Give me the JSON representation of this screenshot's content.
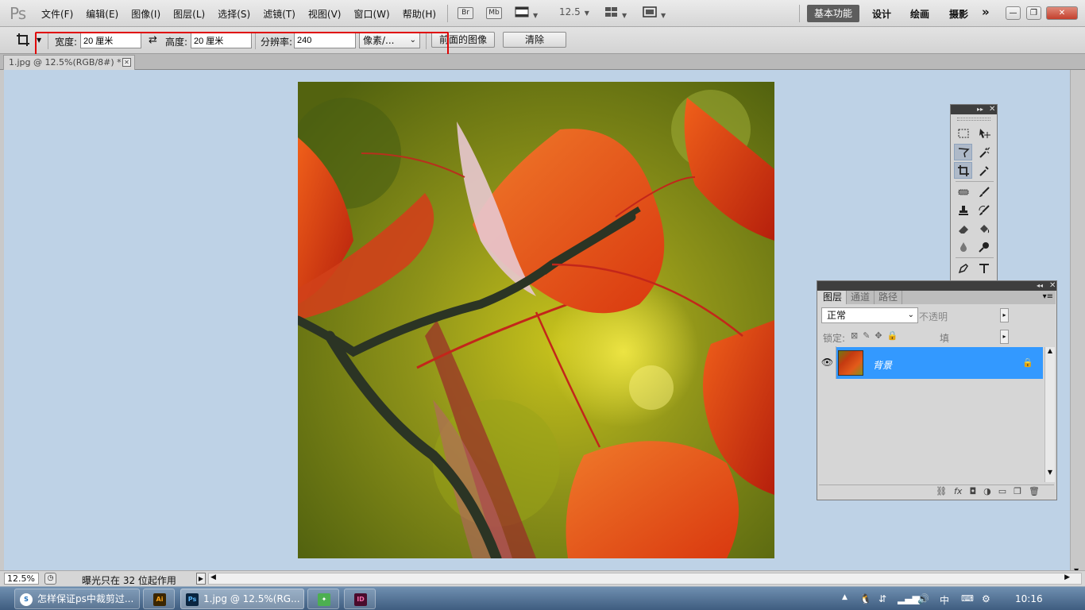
{
  "app": {
    "logo": "Ps"
  },
  "menu": [
    "文件(F)",
    "编辑(E)",
    "图像(I)",
    "图层(L)",
    "选择(S)",
    "滤镜(T)",
    "视图(V)",
    "窗口(W)",
    "帮助(H)"
  ],
  "toolbar": {
    "bridge_label": "Br",
    "minibridge_label": "Mb",
    "zoom_value": "12.5",
    "workspaces": [
      "基本功能",
      "设计",
      "绘画",
      "摄影"
    ],
    "more": "»"
  },
  "options": {
    "width_label": "宽度:",
    "width_value": "20 厘米",
    "height_label": "高度:",
    "height_value": "20 厘米",
    "resolution_label": "分辨率:",
    "resolution_value": "240",
    "unit_value": "像素/...",
    "front_image_label": "前面的图像",
    "clear_label": "清除"
  },
  "document": {
    "tab_title": "1.jpg @ 12.5%(RGB/8#) *"
  },
  "layers_panel": {
    "tabs": [
      "图层",
      "通道",
      "路径"
    ],
    "blend_mode": "正常",
    "opacity_label": "不透明",
    "lock_label": "锁定:",
    "fill_label": "填",
    "layer_name": "背景"
  },
  "colors": {
    "foreground": "#ff0000",
    "background": "#ffffff",
    "layer_selected": "#3399ff"
  },
  "status": {
    "zoom": "12.5%",
    "message": "曝光只在 32 位起作用"
  },
  "taskbar": {
    "items": [
      "怎样保证ps中裁剪过...",
      "",
      "1.jpg @ 12.5%(RG...",
      "",
      ""
    ],
    "ime": "中",
    "time": "10:16"
  }
}
